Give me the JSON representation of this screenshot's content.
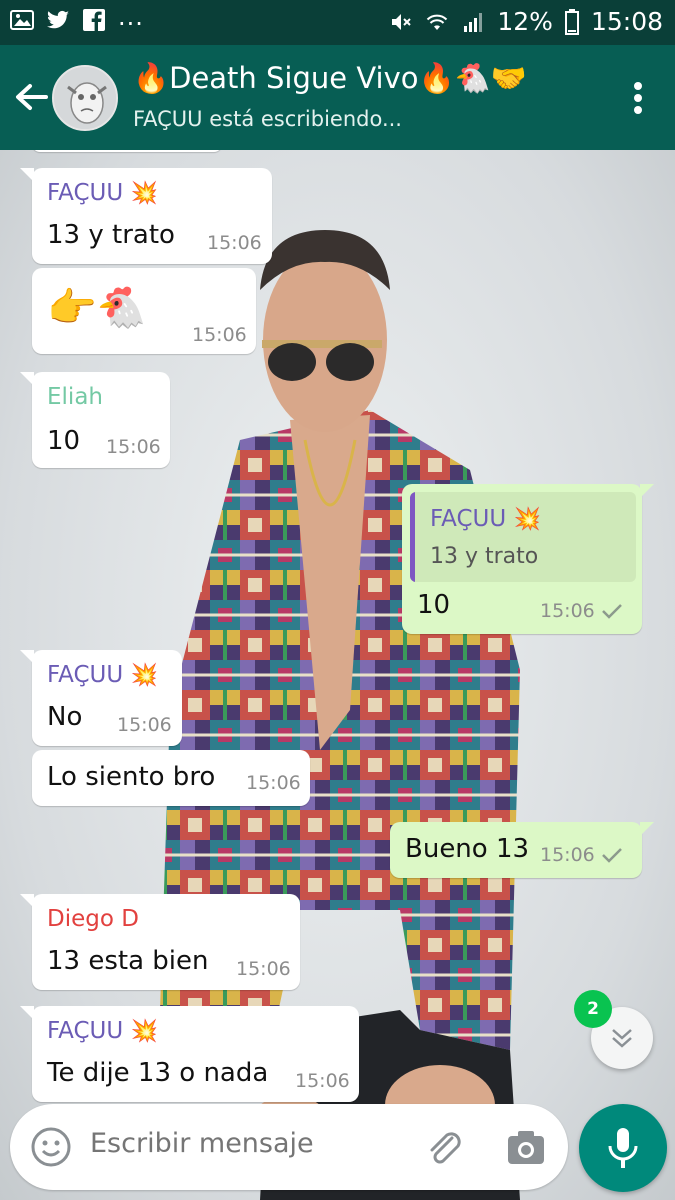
{
  "status_bar": {
    "notif_icons": [
      "image-icon",
      "twitter-icon",
      "facebook-icon"
    ],
    "more": "...",
    "battery": "12%",
    "time": "15:08"
  },
  "header": {
    "title": "🔥Death Sigue Vivo🔥🐔🤝",
    "subtitle": "FAÇUU está escribiendo..."
  },
  "messages": [
    {
      "sender": "FAÇUU",
      "badge": "💥",
      "text": "13 y trato",
      "time": "15:06",
      "sender_color": "#6b5cb5"
    },
    {
      "text": "👉🐔",
      "time": "15:06"
    },
    {
      "sender": "Eliah",
      "text": "10",
      "time": "15:06",
      "sender_color": "#74c9a4"
    },
    {
      "quote_sender": "FAÇUU",
      "quote_badge": "💥",
      "quote_text": "13 y trato",
      "text": "10",
      "time": "15:06",
      "outgoing": true
    },
    {
      "sender": "FAÇUU",
      "badge": "💥",
      "text": "No",
      "time": "15:06",
      "sender_color": "#6b5cb5"
    },
    {
      "text": "Lo siento bro",
      "time": "15:06"
    },
    {
      "text": "Bueno 13",
      "time": "15:06",
      "outgoing": true
    },
    {
      "sender": "Diego D",
      "text": "13 esta bien",
      "time": "15:06",
      "sender_color": "#e2413f"
    },
    {
      "sender": "FAÇUU",
      "badge": "💥",
      "text": "Te dije 13 o nada",
      "time": "15:06",
      "sender_color": "#6b5cb5"
    }
  ],
  "unread_count": "2",
  "compose": {
    "placeholder": "Escribir mensaje"
  },
  "colors": {
    "appbar": "#075e54",
    "statusbar": "#0a3f38",
    "outgoing_bubble": "#dcf8c6",
    "fab": "#00897b",
    "unread_badge": "#09c350"
  }
}
